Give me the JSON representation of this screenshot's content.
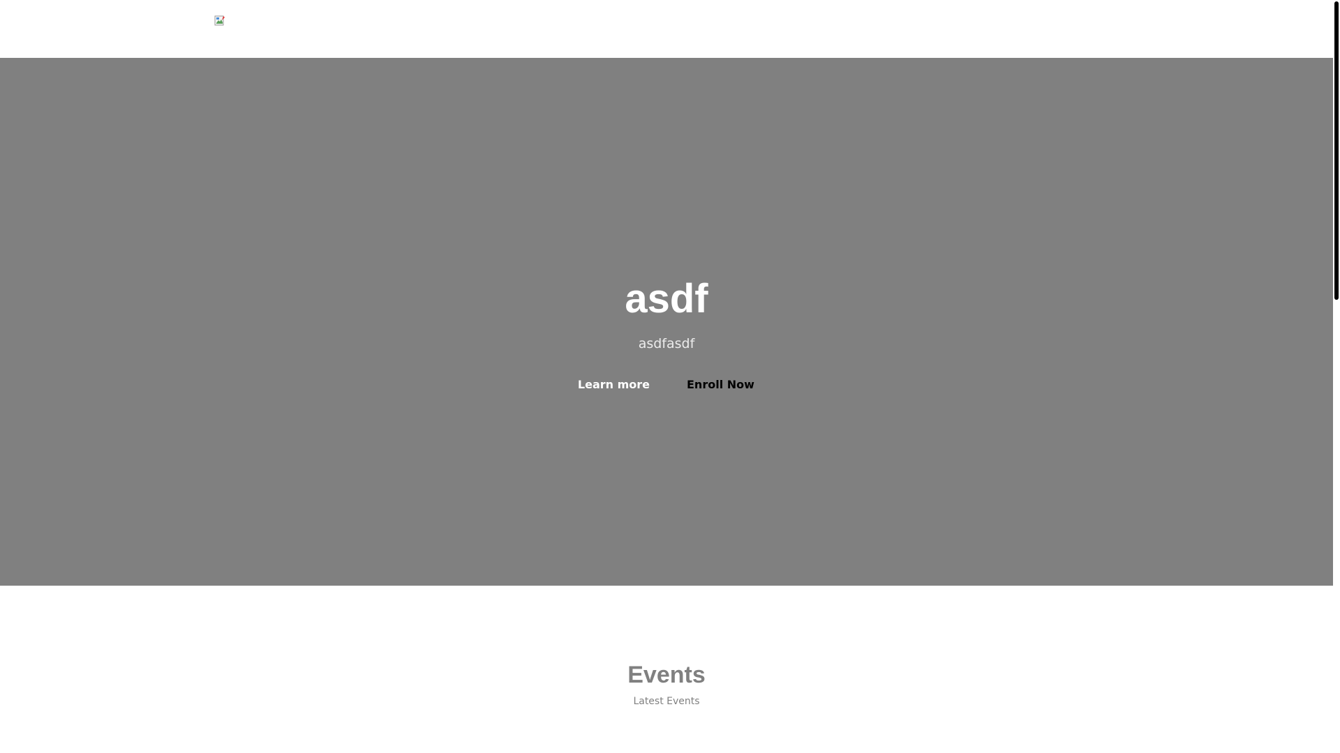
{
  "header": {
    "logo_alt": "broken-image-icon"
  },
  "hero": {
    "title": "asdf",
    "subtitle": "asdfasdf",
    "learn_more_label": "Learn more",
    "enroll_label": "Enroll Now",
    "background_color": "#808080"
  },
  "events": {
    "title": "Events",
    "subtitle": "Latest Events"
  }
}
